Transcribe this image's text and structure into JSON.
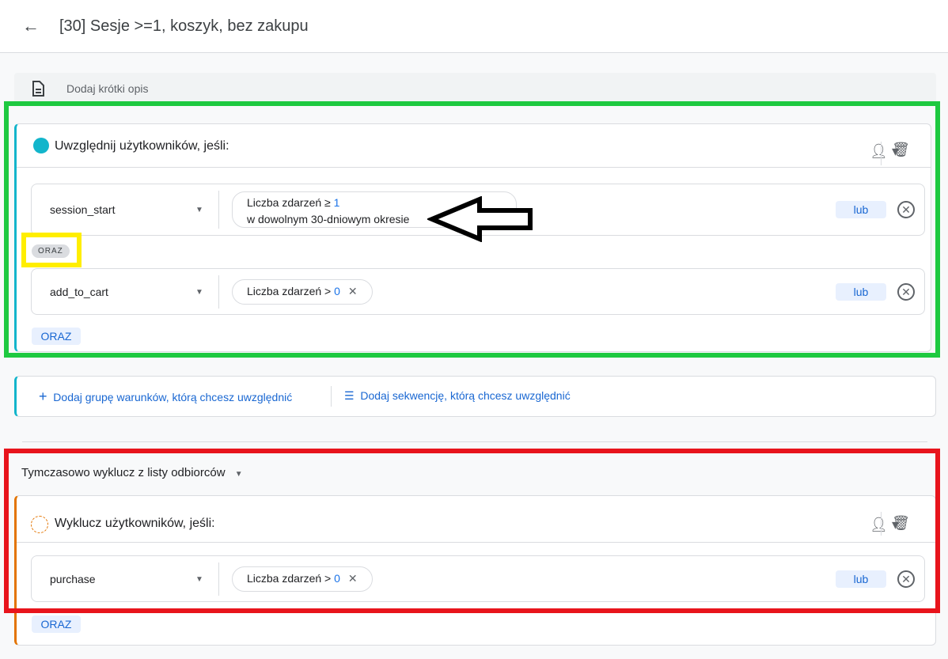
{
  "header": {
    "back_icon": "arrow-left-icon",
    "title": "[30] Sesje >=1, koszyk, bez zakupu"
  },
  "description": {
    "icon": "document-icon",
    "placeholder": "Dodaj krótki opis"
  },
  "include_group": {
    "title": "Uwzględnij użytkowników, jeśli:",
    "dot_color": "#12b5cb",
    "conditions": [
      {
        "event": "session_start",
        "filter_line1": "Liczba zdarzeń ≥ ",
        "filter_value": "1",
        "filter_line2": "w dowolnym 30-dniowym okresie",
        "or_label": "lub"
      },
      {
        "event": "add_to_cart",
        "filter_line1": "Liczba zdarzeń > ",
        "filter_value": "0",
        "or_label": "lub"
      }
    ],
    "and_chip": "ORAZ",
    "and_button": "ORAZ"
  },
  "add_actions": {
    "add_group": "Dodaj grupę warunków, którą chcesz uwzględnić",
    "add_sequence": "Dodaj sekwencję, którą chcesz uwzględnić"
  },
  "exclude_section": {
    "mode": "Tymczasowo wyklucz z listy odbiorców",
    "title": "Wyklucz użytkowników, jeśli:",
    "accent": "#e37400",
    "conditions": [
      {
        "event": "purchase",
        "filter_line1": "Liczba zdarzeń > ",
        "filter_value": "0",
        "or_label": "lub"
      }
    ],
    "and_button": "ORAZ"
  },
  "annotations": {
    "green": "#1ec940",
    "yellow": "#ffee00",
    "red": "#e8141c"
  }
}
